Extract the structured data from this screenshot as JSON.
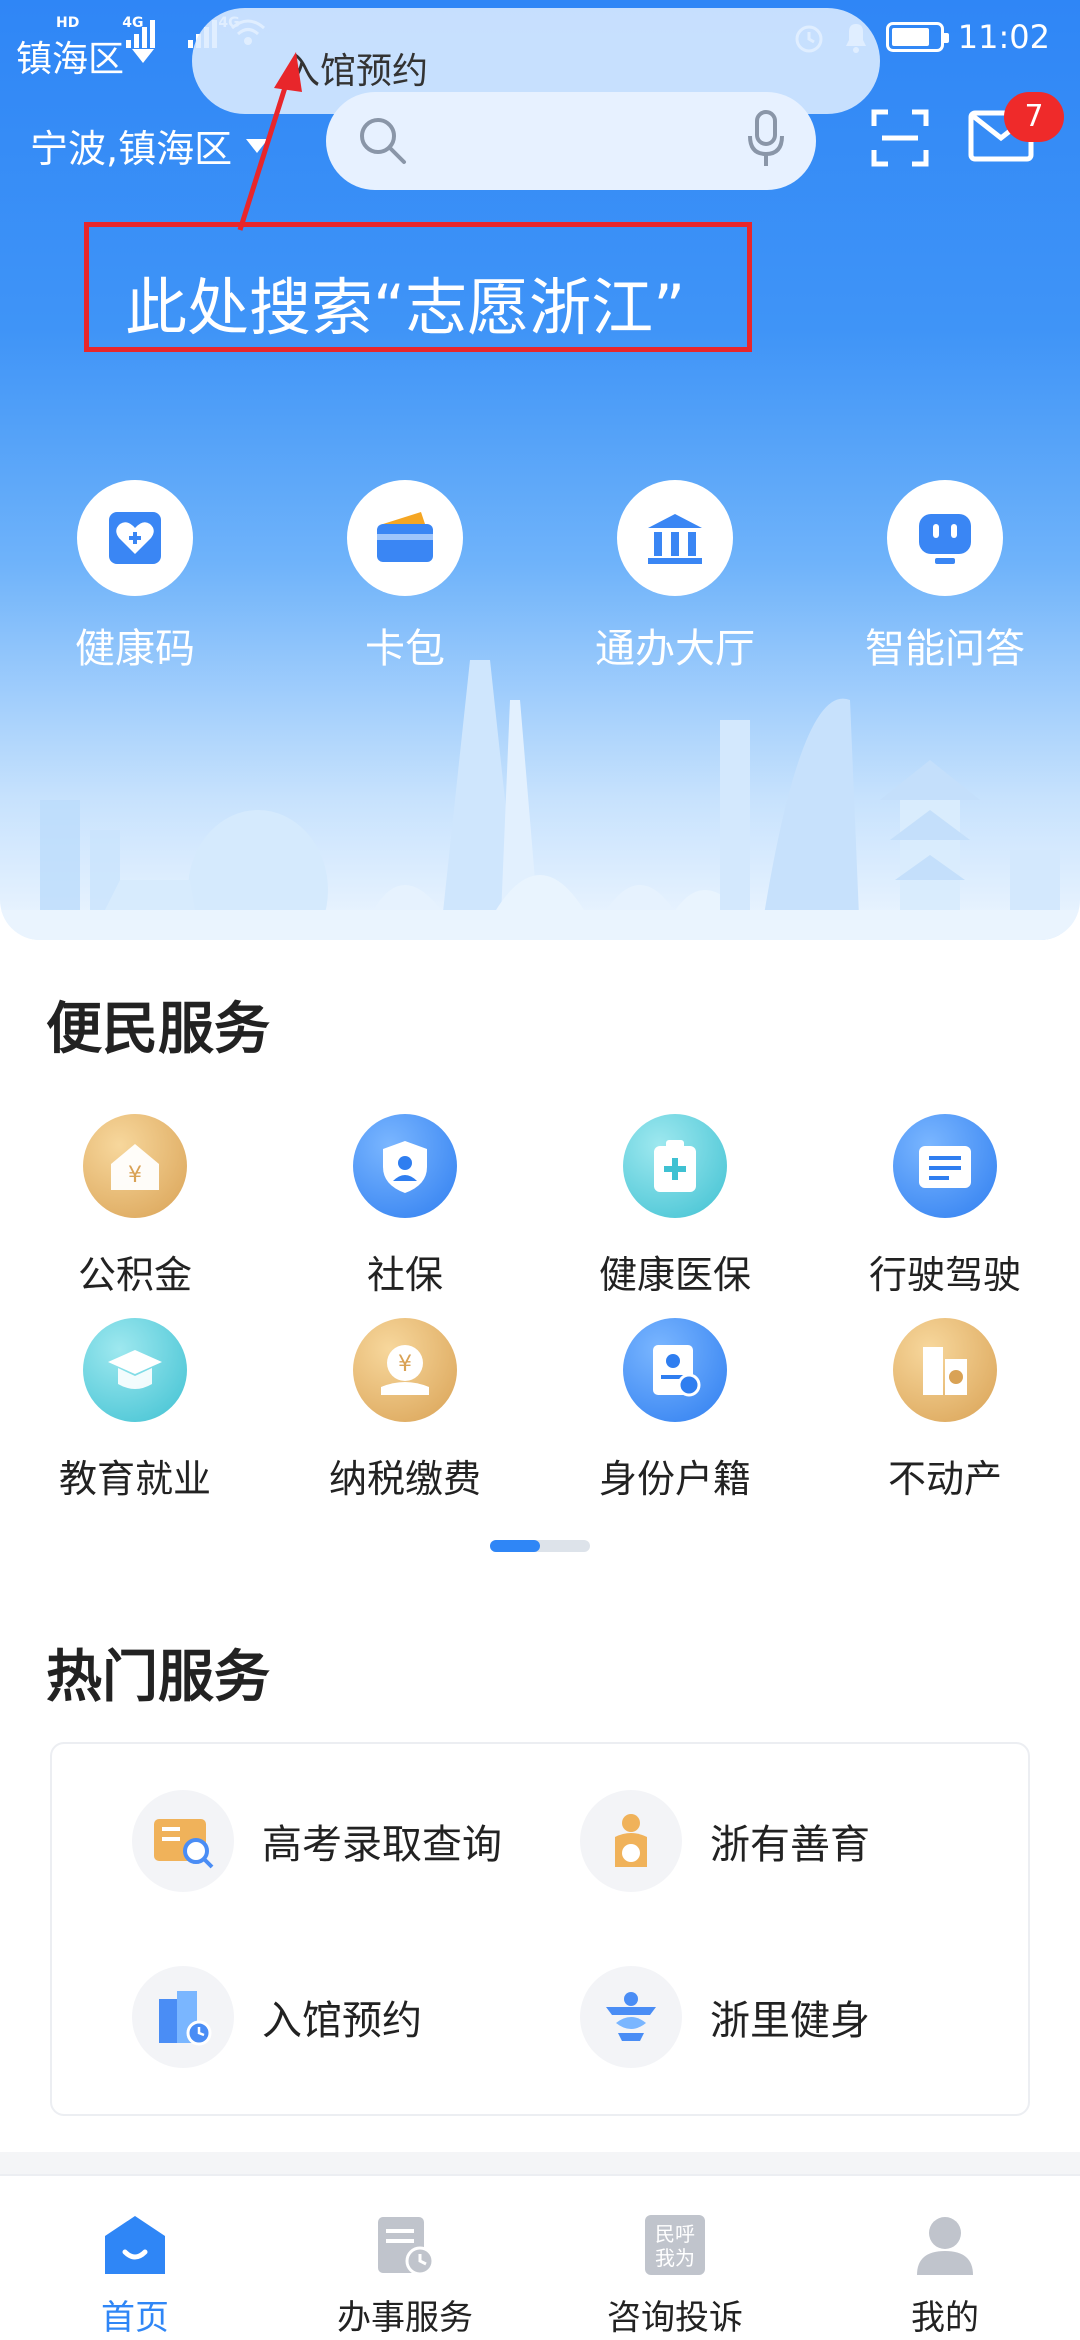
{
  "status_bar": {
    "network_left": "HD",
    "network_left_2": "4G",
    "network_right": "4G",
    "time": "11:02",
    "battery_level": 0.8
  },
  "overlay": {
    "region_label": "镇海区",
    "hint_text": "入馆预约"
  },
  "header": {
    "location": "宁波,镇海区",
    "mail_badge": "7"
  },
  "annotation": {
    "text": "此处搜索“志愿浙江”"
  },
  "quick_actions": [
    {
      "label": "健康码",
      "icon": "health-code-icon"
    },
    {
      "label": "卡包",
      "icon": "card-wallet-icon"
    },
    {
      "label": "通办大厅",
      "icon": "service-hall-icon"
    },
    {
      "label": "智能问答",
      "icon": "robot-qa-icon"
    }
  ],
  "services": {
    "title": "便民服务",
    "items": [
      {
        "label": "公积金",
        "icon": "housing-fund-icon"
      },
      {
        "label": "社保",
        "icon": "social-security-icon"
      },
      {
        "label": "健康医保",
        "icon": "medical-insurance-icon"
      },
      {
        "label": "行驶驾驶",
        "icon": "driving-license-icon"
      },
      {
        "label": "教育就业",
        "icon": "education-icon"
      },
      {
        "label": "纳税缴费",
        "icon": "tax-payment-icon"
      },
      {
        "label": "身份户籍",
        "icon": "id-household-icon"
      },
      {
        "label": "不动产",
        "icon": "real-estate-icon"
      }
    ],
    "page_index": 1,
    "page_count": 2
  },
  "hot_services": {
    "title": "热门服务",
    "items": [
      {
        "label": "高考录取查询",
        "icon": "exam-admission-icon"
      },
      {
        "label": "浙有善育",
        "icon": "child-care-icon"
      },
      {
        "label": "入馆预约",
        "icon": "venue-booking-icon"
      },
      {
        "label": "浙里健身",
        "icon": "fitness-icon"
      }
    ]
  },
  "tabbar": {
    "items": [
      {
        "label": "首页",
        "active": true
      },
      {
        "label": "办事服务",
        "active": false
      },
      {
        "label": "咨询投诉",
        "active": false,
        "icon_text_1": "民呼",
        "icon_text_2": "我为"
      },
      {
        "label": "我的",
        "active": false
      }
    ]
  },
  "colors": {
    "primary": "#2f86f6",
    "badge": "#ef2a2a",
    "annotation": "#e8262b"
  }
}
